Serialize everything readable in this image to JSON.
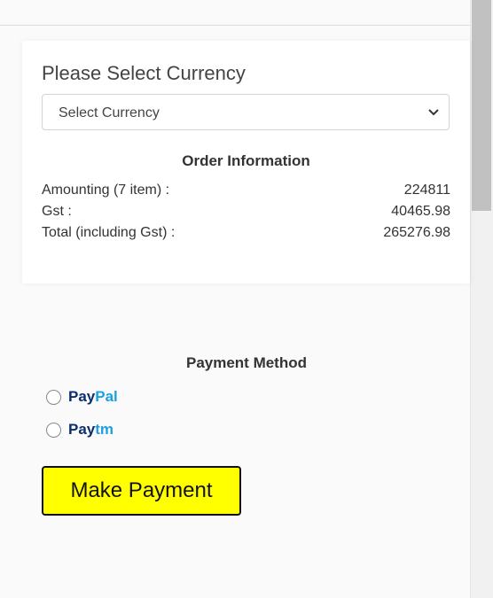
{
  "currency": {
    "title": "Please Select Currency",
    "select_value": "Select Currency"
  },
  "order": {
    "title": "Order Information",
    "rows": [
      {
        "label": "Amounting (7 item) :",
        "value": "224811"
      },
      {
        "label": "Gst :",
        "value": "40465.98"
      },
      {
        "label": "Total (including Gst) :",
        "value": "265276.98"
      }
    ]
  },
  "payment": {
    "title": "Payment Method",
    "options": [
      {
        "part1": "Pay",
        "part2": "Pal",
        "selected": false
      },
      {
        "part1": "Pay",
        "part2": "tm",
        "selected": false
      }
    ],
    "button_label": "Make Payment"
  },
  "colors": {
    "brand_dark": "#0b2d6b",
    "brand_light": "#1ba1e2",
    "button_bg": "#ffff00"
  }
}
